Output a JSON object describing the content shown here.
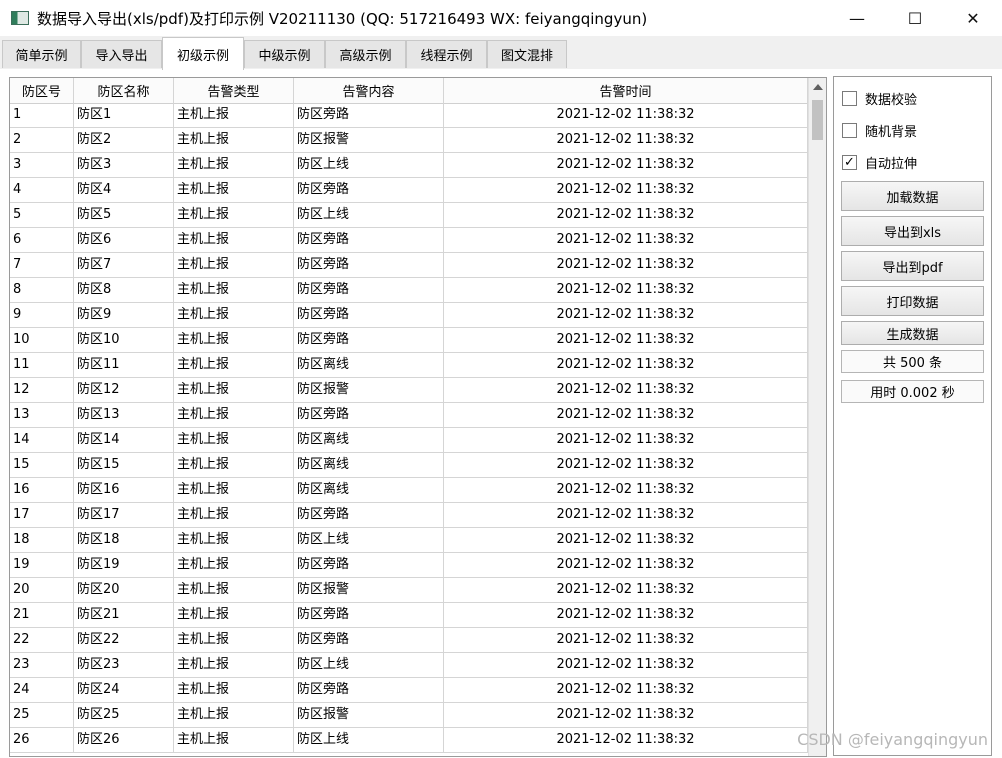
{
  "window": {
    "title": "数据导入导出(xls/pdf)及打印示例 V20211130 (QQ: 517216493 WX: feiyangqingyun)",
    "minimize": "—",
    "maximize": "☐",
    "close": "✕"
  },
  "tabs": [
    "简单示例",
    "导入导出",
    "初级示例",
    "中级示例",
    "高级示例",
    "线程示例",
    "图文混排"
  ],
  "active_tab": "初级示例",
  "table": {
    "headers": [
      "防区号",
      "防区名称",
      "告警类型",
      "告警内容",
      "告警时间"
    ],
    "rows": [
      [
        "1",
        "防区1",
        "主机上报",
        "防区旁路",
        "2021-12-02 11:38:32"
      ],
      [
        "2",
        "防区2",
        "主机上报",
        "防区报警",
        "2021-12-02 11:38:32"
      ],
      [
        "3",
        "防区3",
        "主机上报",
        "防区上线",
        "2021-12-02 11:38:32"
      ],
      [
        "4",
        "防区4",
        "主机上报",
        "防区旁路",
        "2021-12-02 11:38:32"
      ],
      [
        "5",
        "防区5",
        "主机上报",
        "防区上线",
        "2021-12-02 11:38:32"
      ],
      [
        "6",
        "防区6",
        "主机上报",
        "防区旁路",
        "2021-12-02 11:38:32"
      ],
      [
        "7",
        "防区7",
        "主机上报",
        "防区旁路",
        "2021-12-02 11:38:32"
      ],
      [
        "8",
        "防区8",
        "主机上报",
        "防区旁路",
        "2021-12-02 11:38:32"
      ],
      [
        "9",
        "防区9",
        "主机上报",
        "防区旁路",
        "2021-12-02 11:38:32"
      ],
      [
        "10",
        "防区10",
        "主机上报",
        "防区旁路",
        "2021-12-02 11:38:32"
      ],
      [
        "11",
        "防区11",
        "主机上报",
        "防区离线",
        "2021-12-02 11:38:32"
      ],
      [
        "12",
        "防区12",
        "主机上报",
        "防区报警",
        "2021-12-02 11:38:32"
      ],
      [
        "13",
        "防区13",
        "主机上报",
        "防区旁路",
        "2021-12-02 11:38:32"
      ],
      [
        "14",
        "防区14",
        "主机上报",
        "防区离线",
        "2021-12-02 11:38:32"
      ],
      [
        "15",
        "防区15",
        "主机上报",
        "防区离线",
        "2021-12-02 11:38:32"
      ],
      [
        "16",
        "防区16",
        "主机上报",
        "防区离线",
        "2021-12-02 11:38:32"
      ],
      [
        "17",
        "防区17",
        "主机上报",
        "防区旁路",
        "2021-12-02 11:38:32"
      ],
      [
        "18",
        "防区18",
        "主机上报",
        "防区上线",
        "2021-12-02 11:38:32"
      ],
      [
        "19",
        "防区19",
        "主机上报",
        "防区旁路",
        "2021-12-02 11:38:32"
      ],
      [
        "20",
        "防区20",
        "主机上报",
        "防区报警",
        "2021-12-02 11:38:32"
      ],
      [
        "21",
        "防区21",
        "主机上报",
        "防区旁路",
        "2021-12-02 11:38:32"
      ],
      [
        "22",
        "防区22",
        "主机上报",
        "防区旁路",
        "2021-12-02 11:38:32"
      ],
      [
        "23",
        "防区23",
        "主机上报",
        "防区上线",
        "2021-12-02 11:38:32"
      ],
      [
        "24",
        "防区24",
        "主机上报",
        "防区旁路",
        "2021-12-02 11:38:32"
      ],
      [
        "25",
        "防区25",
        "主机上报",
        "防区报警",
        "2021-12-02 11:38:32"
      ],
      [
        "26",
        "防区26",
        "主机上报",
        "防区上线",
        "2021-12-02 11:38:32"
      ]
    ]
  },
  "sidebar": {
    "checkboxes": [
      {
        "label": "数据校验",
        "checked": false
      },
      {
        "label": "随机背景",
        "checked": false
      },
      {
        "label": "自动拉伸",
        "checked": true
      }
    ],
    "check_mark": "✓",
    "buttons": [
      "加载数据",
      "导出到xls",
      "导出到pdf",
      "打印数据",
      "生成数据"
    ],
    "total_label": "共 500 条",
    "time_label": "用时 0.002 秒"
  },
  "watermark": "CSDN @feiyangqingyun"
}
